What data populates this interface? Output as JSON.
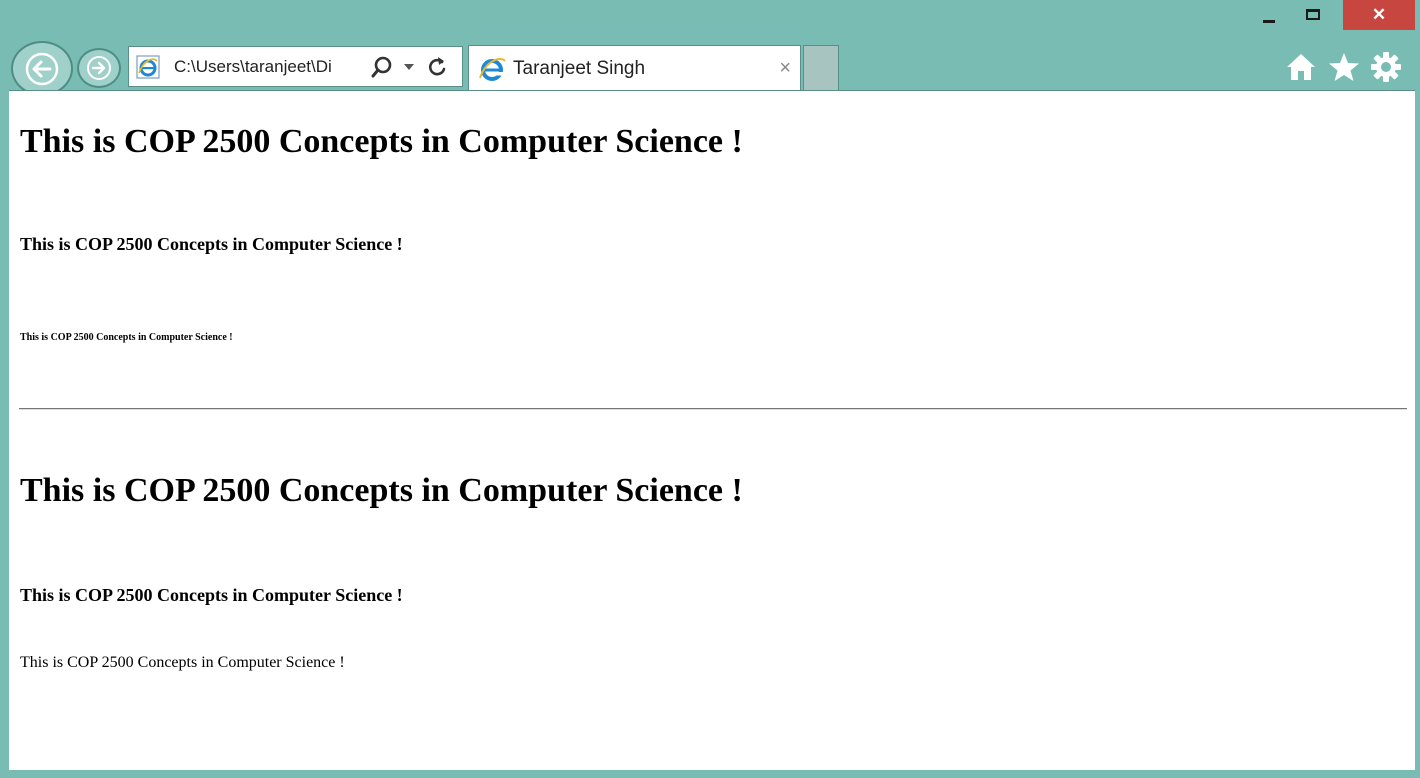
{
  "window": {
    "close_glyph": "✕"
  },
  "address_bar": {
    "url": "C:\\Users\\taranjeet\\Di"
  },
  "tab": {
    "title": "Taranjeet Singh",
    "close_glyph": "×"
  },
  "toolbar_icons": [
    "home-icon",
    "favorites-icon",
    "settings-icon"
  ],
  "content": {
    "heading1_a": "This is COP 2500 Concepts in Computer Science !",
    "heading4_a": "This is COP 2500 Concepts in Computer Science !",
    "heading6_a": "This is COP 2500 Concepts in Computer Science !",
    "heading1_b": "This is COP 2500 Concepts in Computer Science !",
    "heading4_b": "This is COP 2500 Concepts in Computer Science !",
    "paragraph_b": "This is COP 2500 Concepts in Computer Science !"
  },
  "colors": {
    "chrome_bg": "#78bcb3",
    "close_button": "#c7463f",
    "ie_blue": "#1e88d6",
    "ie_gold": "#e8b92e"
  }
}
